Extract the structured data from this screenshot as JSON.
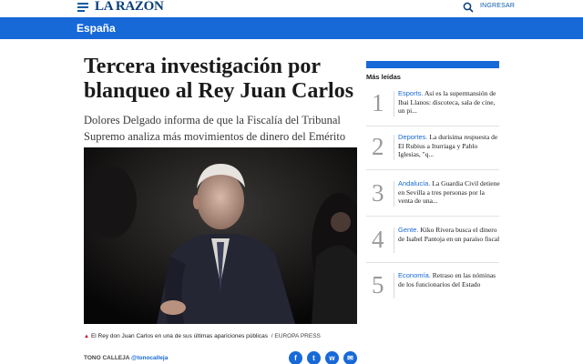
{
  "header": {
    "logo": "LA RAZÓN",
    "login_label": "INGRESAR"
  },
  "section": {
    "label": "España"
  },
  "article": {
    "headline": "Tercera investigación por blanqueo al Rey Juan Carlos",
    "subtitle": "Dolores Delgado informa de que la Fiscalía del Tribunal Supremo analiza más movimientos de dinero del Emérito",
    "caption": "El Rey don Juan Carlos en una de sus últimas apariciones públicas",
    "caption_credit": "/ EUROPA PRESS",
    "author": "TONO CALLEJA",
    "author_handle": "@tonocalleja"
  },
  "share": {
    "facebook": "f",
    "twitter": "t",
    "whatsapp": "w",
    "email": "✉"
  },
  "most_read": {
    "title": "Más leídas",
    "items": [
      {
        "number": "1",
        "category": "Esports.",
        "text": "Así es la supermansión de Ibai Llanos: discoteca, sala de cine, un pi..."
      },
      {
        "number": "2",
        "category": "Deportes.",
        "text": "La durísima respuesta de El Rubius a Iturriaga y Pablo Iglesias, \"q..."
      },
      {
        "number": "3",
        "category": "Andalucía.",
        "text": "La Guardia Civil detiene en Sevilla a tres personas por la venta de una..."
      },
      {
        "number": "4",
        "category": "Gente.",
        "text": "Kiko Rivera busca el dinero de Isabel Pantoja en un paraíso fiscal"
      },
      {
        "number": "5",
        "category": "Economía.",
        "text": "Retraso en las nóminas de los funcionarios del Estado"
      }
    ]
  },
  "colors": {
    "brand_blue": "#1869d8",
    "logo_navy": "#0a3f7a",
    "caption_arrow": "#d0021b"
  }
}
